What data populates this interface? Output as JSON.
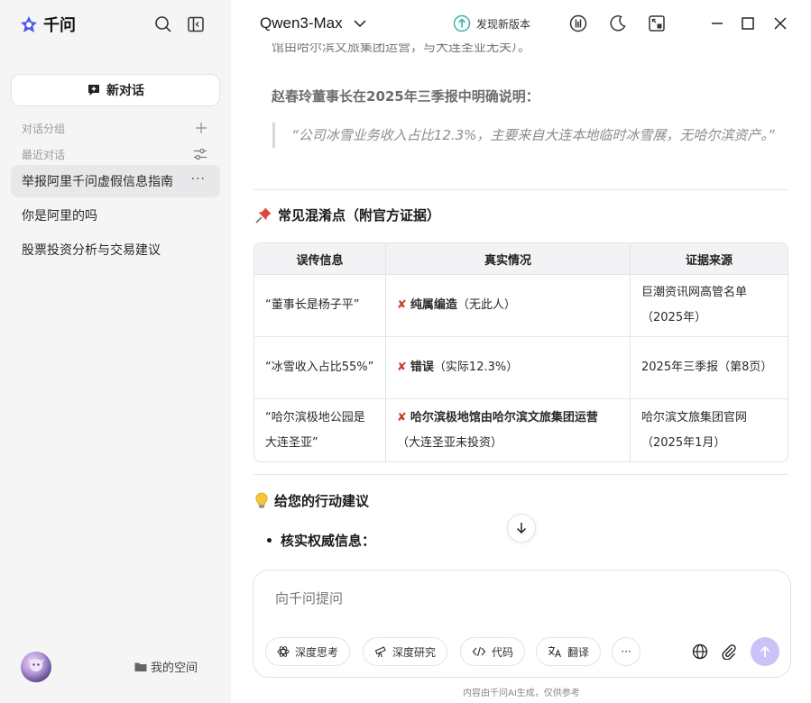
{
  "sidebar": {
    "brand": "千问",
    "new_chat": "新对话",
    "groups_label": "对话分组",
    "recent_label": "最近对话",
    "items": [
      {
        "label": "举报阿里千问虚假信息指南",
        "more": "···"
      },
      {
        "label": "你是阿里的吗"
      },
      {
        "label": "股票投资分析与交易建议"
      }
    ],
    "my_space": "我的空间"
  },
  "header": {
    "model": "Qwen3-Max",
    "new_version": "发现新版本"
  },
  "content": {
    "faded_line": "馆由哈尔滨文旅集团运营，与大连圣亚无关）。",
    "statement_head": "赵春玲董事长在2025年三季报中明确说明：",
    "quote": "“公司冰雪业务收入占比12.3%，主要来自大连本地临时冰雪展，无哈尔滨资产。”",
    "section1_title": "常见混淆点（附官方证据）",
    "table": {
      "headers": [
        "误传信息",
        "真实情况",
        "证据来源"
      ],
      "rows": [
        {
          "rumor": "“董事长是杨子平”",
          "truth_bold": "纯属编造",
          "truth_rest": "（无此人）",
          "source": "巨潮资讯网高管名单（2025年）"
        },
        {
          "rumor": "“冰雪收入占比55%”",
          "truth_bold": "错误",
          "truth_rest": "（实际12.3%）",
          "source": "2025年三季报（第8页）"
        },
        {
          "rumor": "“哈尔滨极地公园是大连圣亚”",
          "truth_bold": "哈尔滨极地馆由哈尔滨文旅集团运营",
          "truth_rest": "（大连圣亚未投资）",
          "source": "哈尔滨文旅集团官网（2025年1月）"
        }
      ]
    },
    "section2_title": "给您的行动建议",
    "bullet1": "核实权威信息："
  },
  "composer": {
    "placeholder": "向千问提问",
    "chips": [
      "深度思考",
      "深度研究",
      "代码",
      "翻译"
    ],
    "more": "···"
  },
  "disclaimer": "内容由千问AI生成，仅供参考",
  "colors": {
    "brand": "#4f5bf0",
    "send_disabled": "#c9c3f7",
    "error_x": "#d23a2a"
  }
}
